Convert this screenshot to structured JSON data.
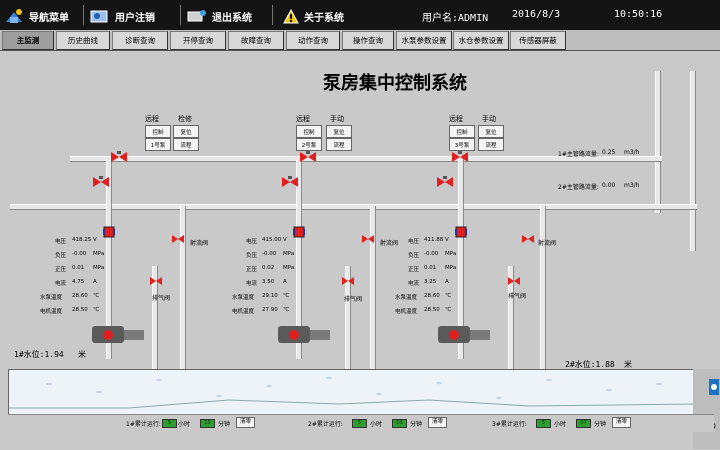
{
  "topbar": {
    "nav_home": "导航菜单",
    "user_logout": "用户注销",
    "exit_system": "退出系统",
    "about_system": "关于系统",
    "username": "用户名:ADMIN",
    "date": "2016/8/3",
    "time": "10:50:16"
  },
  "tabs": [
    "主监测",
    "历史曲线",
    "诊断查询",
    "开停查询",
    "故障查询",
    "动作查询",
    "操作查询",
    "水泵参数设置",
    "水仓参数设置",
    "传感器屏蔽"
  ],
  "title": "泵房集中控制系统",
  "controls": {
    "remote": "远程",
    "maintain": "检修",
    "manual": "手动",
    "control_btn": "控制",
    "reset_btn": "复位",
    "pump1_btn": "1号泵",
    "pump2_btn": "2号泵",
    "pump3_btn": "3号泵",
    "flow_btn": "流程"
  },
  "main_pipes": {
    "pipe1_label": "1#主管路流量:",
    "pipe1_value": "0.25",
    "pipe1_unit": "m3/h",
    "pipe2_label": "2#主管路流量:",
    "pipe2_value": "0.00",
    "pipe2_unit": "m3/h"
  },
  "valve_labels": {
    "shoot": "射流阀",
    "drain": "排气阀"
  },
  "readout_labels": [
    "电压",
    "负压",
    "正压",
    "电流",
    "水泵温度",
    "电机温度"
  ],
  "readout_units": [
    "V",
    "MPa",
    "MPa",
    "A",
    "℃",
    "℃"
  ],
  "pumps": [
    {
      "values": [
        "418.25",
        "-0.00",
        "0.01",
        "4.75",
        "28.60",
        "28.50"
      ]
    },
    {
      "values": [
        "415.00",
        "-0.00",
        "0.02",
        "3.50",
        "29.10",
        "27.90"
      ]
    },
    {
      "values": [
        "411.88",
        "-0.00",
        "0.01",
        "3.25",
        "28.60",
        "28.50"
      ]
    }
  ],
  "water_levels": {
    "level1": "1#水位:1.94",
    "level1_unit": "米",
    "level2": "2#水位:1.88",
    "level2_unit": "米"
  },
  "footer": {
    "run1": "1#累计运行:",
    "run2": "2#累计运行:",
    "run3": "3#累计运行:",
    "hours_unit": "小时",
    "minutes_unit": "分钟",
    "clear_btn": "清零",
    "counters": [
      [
        "5",
        "15"
      ],
      [
        "5",
        "03"
      ],
      [
        "5",
        "07"
      ]
    ]
  },
  "colors": {
    "topbar": "#141414",
    "background": "#c9c9c9",
    "valve_open": "#e02020",
    "counter": "#2d9e2d",
    "pump_body": "#5a5a5a"
  }
}
